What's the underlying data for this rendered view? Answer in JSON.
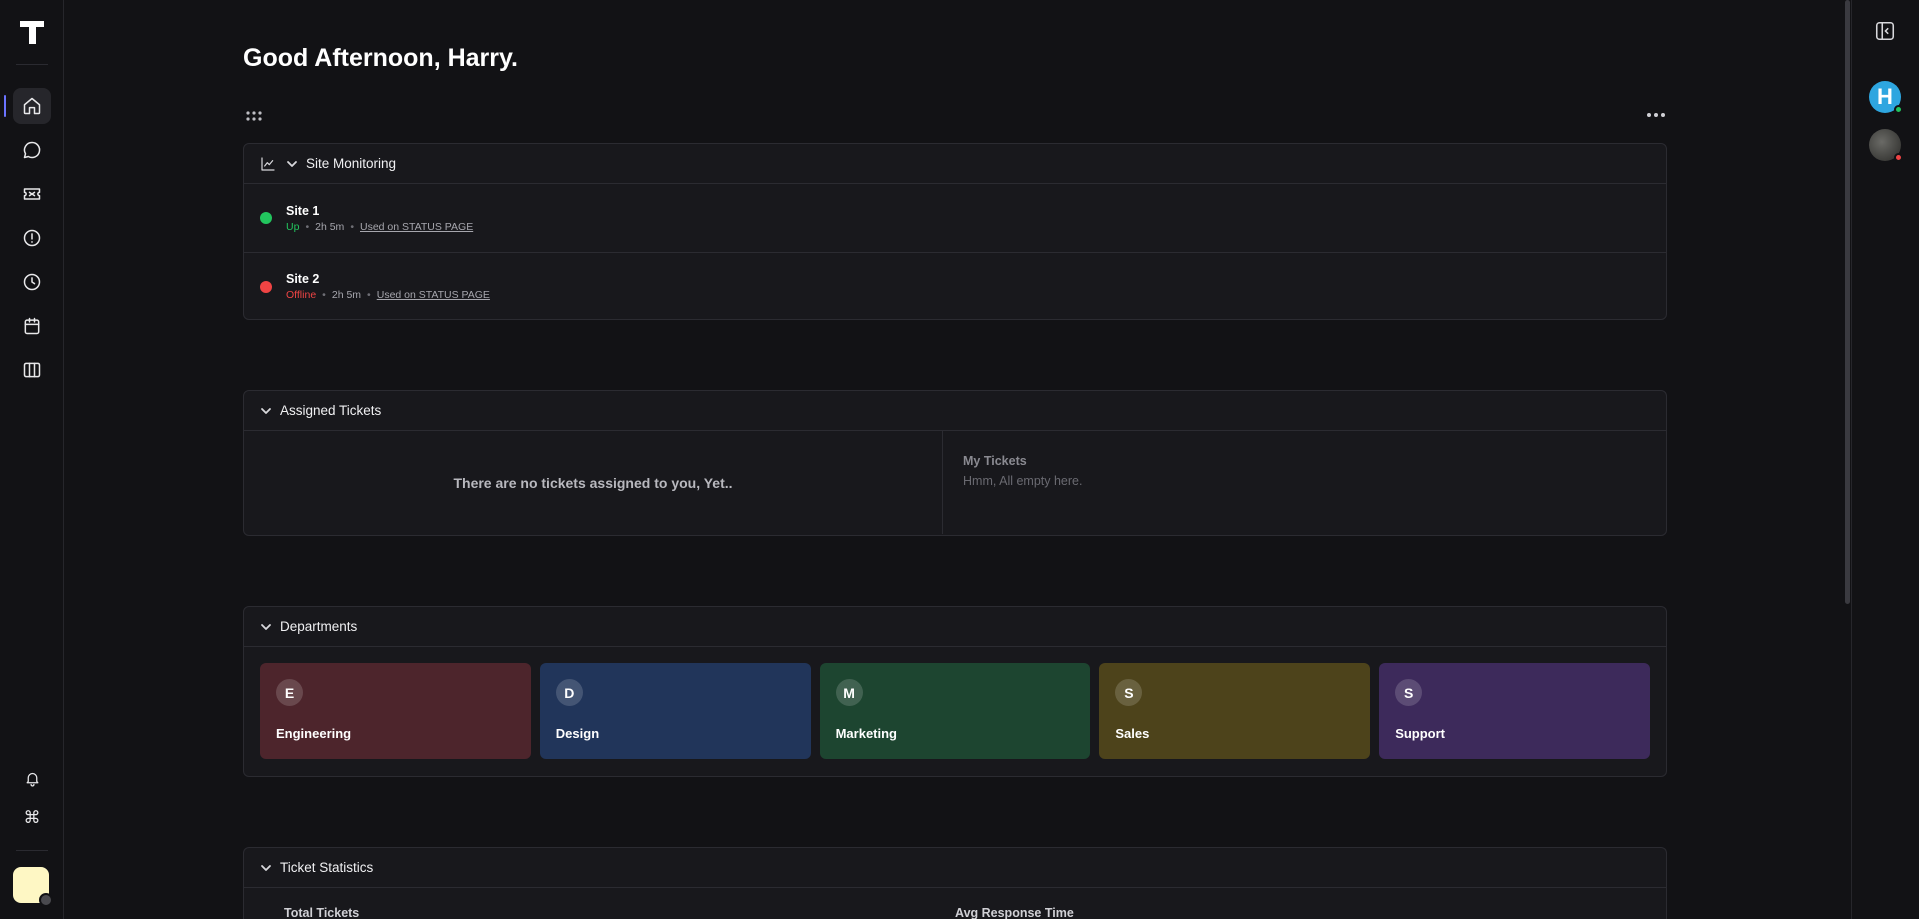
{
  "greeting": "Good Afternoon, Harry.",
  "sidebar": {
    "items": [
      {
        "name": "home",
        "icon": "home-icon",
        "active": true
      },
      {
        "name": "chat",
        "icon": "chat-bubble-icon"
      },
      {
        "name": "tickets",
        "icon": "ticket-icon"
      },
      {
        "name": "incidents",
        "icon": "alert-circle-icon"
      },
      {
        "name": "history",
        "icon": "clock-icon"
      },
      {
        "name": "calendar",
        "icon": "calendar-icon"
      },
      {
        "name": "board",
        "icon": "columns-icon"
      }
    ],
    "bottom": [
      {
        "name": "notifications",
        "icon": "bell-icon"
      },
      {
        "name": "command",
        "icon": "command-icon",
        "glyph": "⌘"
      }
    ],
    "accent": "#6b73ff",
    "user_avatar_color": "#fef7c4"
  },
  "rightbar": {
    "avatars": [
      {
        "initial": "H",
        "status_color": "#22c55e"
      },
      {
        "status_color": "#ef4444"
      }
    ]
  },
  "site_monitoring": {
    "title": "Site Monitoring",
    "sites": [
      {
        "name": "Site 1",
        "status": "Up",
        "status_color": "#22c55e",
        "uptime": "2h 5m",
        "link": "Used on STATUS PAGE"
      },
      {
        "name": "Site 2",
        "status": "Offline",
        "status_color": "#ef4444",
        "uptime": "2h 5m",
        "link": "Used on STATUS PAGE"
      }
    ]
  },
  "assigned_tickets": {
    "title": "Assigned Tickets",
    "empty_message": "There are no tickets assigned to you, Yet..",
    "my_tickets_title": "My Tickets",
    "my_tickets_empty": "Hmm, All empty here."
  },
  "departments": {
    "title": "Departments",
    "items": [
      {
        "letter": "E",
        "name": "Engineering",
        "color": "#4d252c"
      },
      {
        "letter": "D",
        "name": "Design",
        "color": "#21355a"
      },
      {
        "letter": "M",
        "name": "Marketing",
        "color": "#1d4530"
      },
      {
        "letter": "S",
        "name": "Sales",
        "color": "#4d431b"
      },
      {
        "letter": "S",
        "name": "Support",
        "color": "#3d2a5b"
      }
    ]
  },
  "ticket_statistics": {
    "title": "Ticket Statistics",
    "labels": [
      "Total Tickets",
      "Avg Response Time"
    ]
  }
}
